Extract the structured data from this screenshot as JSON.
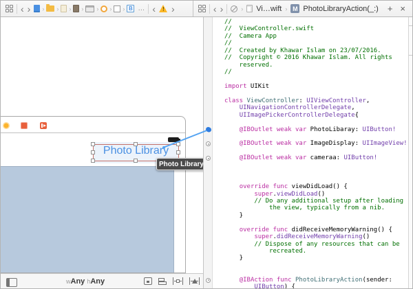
{
  "jumpbar_left": {
    "back": "‹",
    "forward": "›",
    "crumbs": [
      {
        "name": "storyboard-document-icon",
        "cls": "doc-blue"
      },
      {
        "name": "folder-icon",
        "cls": "folder"
      },
      {
        "name": "file-icon-light",
        "cls": "file-light"
      },
      {
        "name": "file-icon-dark",
        "cls": "file-dark"
      },
      {
        "name": "window-icon",
        "cls": "window"
      },
      {
        "name": "view-controller-icon",
        "cls": "vc-circle"
      },
      {
        "name": "view-icon",
        "cls": "view-square"
      },
      {
        "name": "button-icon",
        "cls": "button-b",
        "label": "B"
      }
    ],
    "ellipsis": "…",
    "issue_back": "‹",
    "issue_forward": "›",
    "warning_mark": "!"
  },
  "jumpbar_right": {
    "back": "‹",
    "forward": "›",
    "file_label": "Vi…wift",
    "method_badge": "M",
    "method_label": "PhotoLibraryAction(_:)",
    "add_label": "+",
    "close_label": "×"
  },
  "canvas": {
    "button_title": "Photo Library",
    "tooltip": "Photo Library",
    "size_class": {
      "w_prefix": "w",
      "w_value": "Any",
      "h_prefix": "h",
      "h_value": "Any"
    }
  },
  "colors": {
    "accent_blue": "#4a90e2",
    "connection_line": "#54a3f2",
    "connection_dot": "#2e7ce0",
    "imageview_fill": "#b7c9dd",
    "selection_guide": "#c4716a",
    "comment": "#006f00",
    "keyword": "#ba2da2",
    "type": "#703daa",
    "project_type": "#3f6e74"
  },
  "code": {
    "connection_markers": [
      {
        "line": 16,
        "kind": "blue"
      },
      {
        "line": 18,
        "kind": "gray"
      },
      {
        "line": 20,
        "kind": "gray"
      },
      {
        "line": 37,
        "kind": "gray"
      }
    ],
    "lines": [
      [
        [
          "c",
          "//"
        ]
      ],
      [
        [
          "c",
          "//  ViewController.swift"
        ]
      ],
      [
        [
          "c",
          "//  Camera App"
        ]
      ],
      [
        [
          "c",
          "//"
        ]
      ],
      [
        [
          "c",
          "//  Created by Khawar Islam on 23/07/2016."
        ]
      ],
      [
        [
          "c",
          "//  Copyright © 2016 Khawar Islam. All rights"
        ]
      ],
      [
        [
          "c",
          "    reserved."
        ]
      ],
      [
        [
          "c",
          "//"
        ]
      ],
      [],
      [
        [
          "k",
          "import"
        ],
        [
          "n",
          " UIKit"
        ]
      ],
      [],
      [
        [
          "k",
          "class"
        ],
        [
          "n",
          " "
        ],
        [
          "p",
          "ViewController"
        ],
        [
          "n",
          ": "
        ],
        [
          "t",
          "UIViewController"
        ],
        [
          "n",
          ","
        ]
      ],
      [
        [
          "n",
          "    "
        ],
        [
          "t",
          "UINavigationControllerDelegate"
        ],
        [
          "n",
          ","
        ]
      ],
      [
        [
          "n",
          "    "
        ],
        [
          "t",
          "UIImagePickerControllerDelegate"
        ],
        [
          "n",
          "{"
        ]
      ],
      [],
      [
        [
          "n",
          "    "
        ],
        [
          "k",
          "@IBOutlet"
        ],
        [
          "n",
          " "
        ],
        [
          "k",
          "weak"
        ],
        [
          "n",
          " "
        ],
        [
          "k",
          "var"
        ],
        [
          "n",
          " PhotoLibaray: "
        ],
        [
          "t",
          "UIButton!"
        ]
      ],
      [],
      [
        [
          "n",
          "    "
        ],
        [
          "k",
          "@IBOutlet"
        ],
        [
          "n",
          " "
        ],
        [
          "k",
          "weak"
        ],
        [
          "n",
          " "
        ],
        [
          "k",
          "var"
        ],
        [
          "n",
          " ImageDisplay: "
        ],
        [
          "t",
          "UIImageView!"
        ]
      ],
      [],
      [
        [
          "n",
          "    "
        ],
        [
          "k",
          "@IBOutlet"
        ],
        [
          "n",
          " "
        ],
        [
          "k",
          "weak"
        ],
        [
          "n",
          " "
        ],
        [
          "k",
          "var"
        ],
        [
          "n",
          " cameraa: "
        ],
        [
          "t",
          "UIButton!"
        ]
      ],
      [],
      [],
      [],
      [
        [
          "n",
          "    "
        ],
        [
          "k",
          "override"
        ],
        [
          "n",
          " "
        ],
        [
          "k",
          "func"
        ],
        [
          "n",
          " viewDidLoad() {"
        ]
      ],
      [
        [
          "n",
          "        "
        ],
        [
          "k",
          "super"
        ],
        [
          "n",
          "."
        ],
        [
          "t",
          "viewDidLoad"
        ],
        [
          "n",
          "()"
        ]
      ],
      [
        [
          "c",
          "        // Do any additional setup after loading"
        ]
      ],
      [
        [
          "c",
          "            the view, typically from a nib."
        ]
      ],
      [
        [
          "n",
          "    }"
        ]
      ],
      [],
      [
        [
          "n",
          "    "
        ],
        [
          "k",
          "override"
        ],
        [
          "n",
          " "
        ],
        [
          "k",
          "func"
        ],
        [
          "n",
          " didReceiveMemoryWarning() {"
        ]
      ],
      [
        [
          "n",
          "        "
        ],
        [
          "k",
          "super"
        ],
        [
          "n",
          "."
        ],
        [
          "t",
          "didReceiveMemoryWarning"
        ],
        [
          "n",
          "()"
        ]
      ],
      [
        [
          "c",
          "        // Dispose of any resources that can be"
        ]
      ],
      [
        [
          "c",
          "            recreated."
        ]
      ],
      [
        [
          "n",
          "    }"
        ]
      ],
      [],
      [],
      [
        [
          "n",
          "    "
        ],
        [
          "k",
          "@IBAction"
        ],
        [
          "n",
          " "
        ],
        [
          "k",
          "func"
        ],
        [
          "n",
          " "
        ],
        [
          "p",
          "PhotoLibraryAction"
        ],
        [
          "n",
          "(sender:"
        ]
      ],
      [
        [
          "n",
          "        "
        ],
        [
          "t",
          "UIButton"
        ],
        [
          "n",
          ") {"
        ]
      ]
    ]
  }
}
